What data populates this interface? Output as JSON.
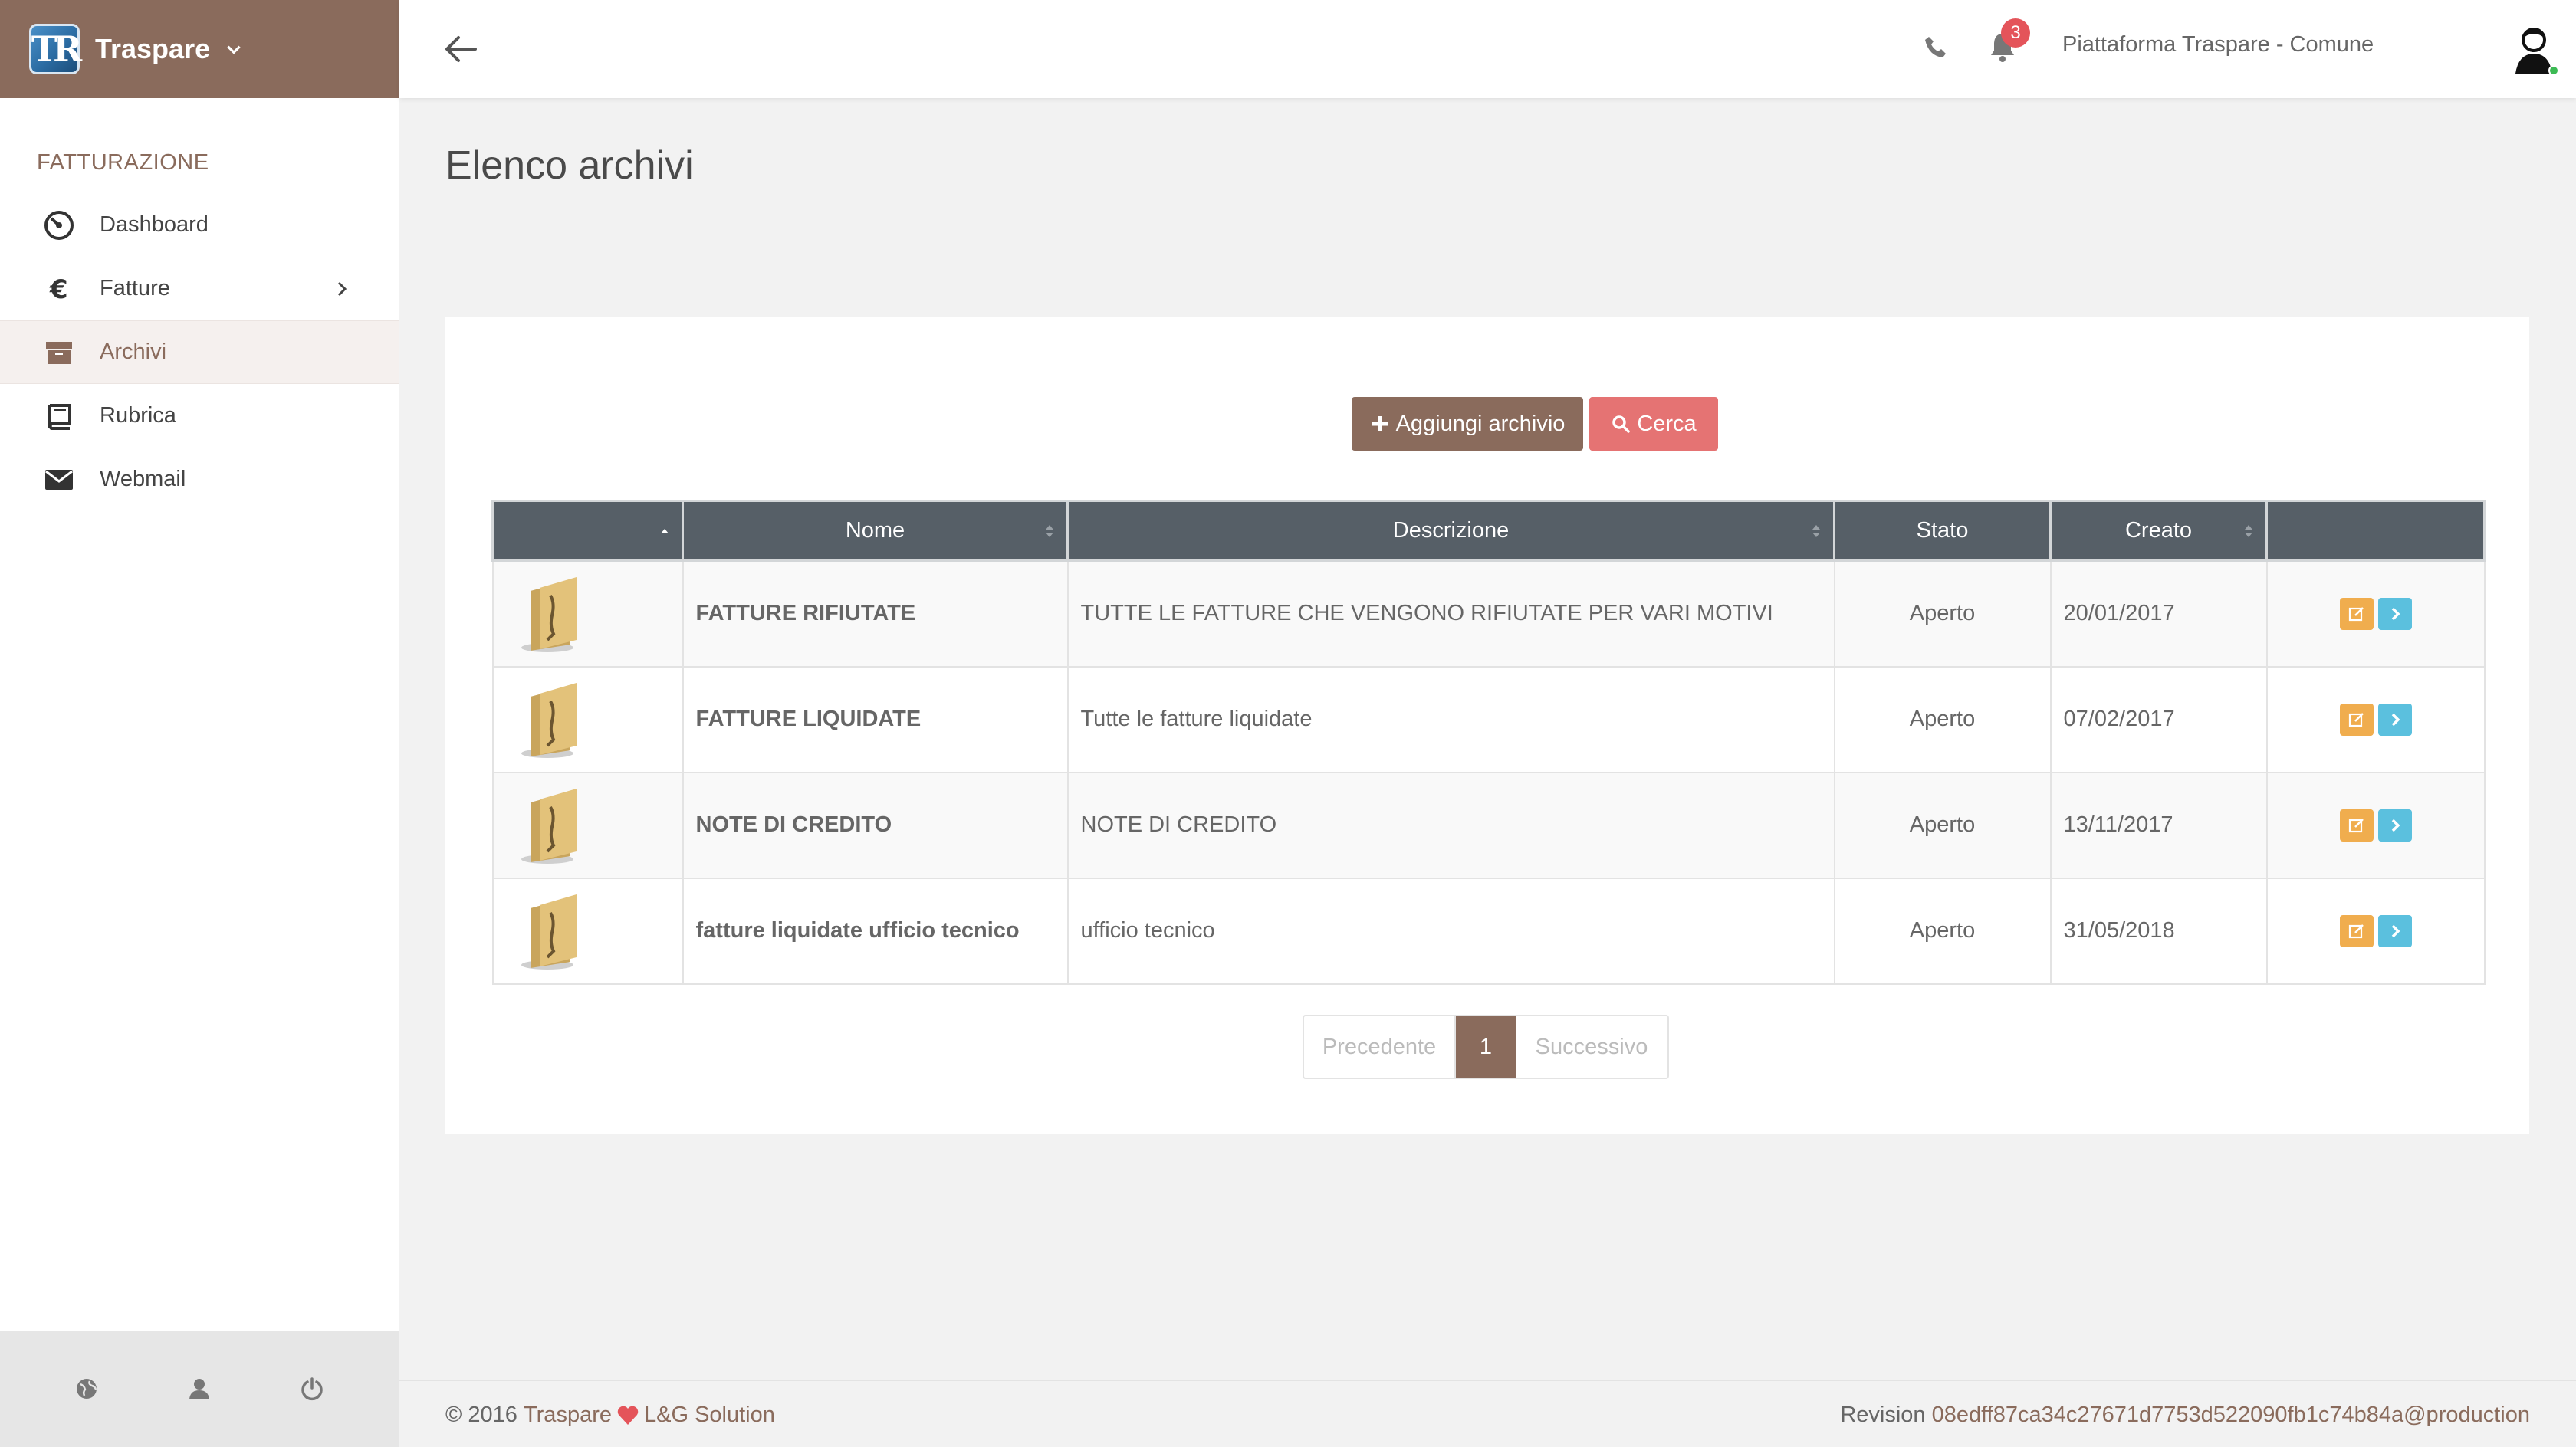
{
  "app": {
    "name": "Traspare",
    "logo_text": "TR"
  },
  "sidebar": {
    "section_title": "FATTURAZIONE",
    "items": [
      {
        "label": "Dashboard",
        "icon": "dashboard-icon"
      },
      {
        "label": "Fatture",
        "icon": "euro-icon",
        "has_submenu": true
      },
      {
        "label": "Archivi",
        "icon": "archive-icon",
        "active": true
      },
      {
        "label": "Rubrica",
        "icon": "book-icon"
      },
      {
        "label": "Webmail",
        "icon": "envelope-icon"
      }
    ],
    "footer_icons": [
      "globe-icon",
      "user-icon",
      "power-icon"
    ]
  },
  "topbar": {
    "notifications_count": "3",
    "org_name": "Piattaforma Traspare - Comune"
  },
  "page": {
    "title": "Elenco archivi"
  },
  "toolbar": {
    "add_label": "Aggiungi archivio",
    "search_label": "Cerca"
  },
  "table": {
    "columns": [
      "",
      "Nome",
      "Descrizione",
      "Stato",
      "Creato",
      ""
    ],
    "rows": [
      {
        "nome": "FATTURE RIFIUTATE",
        "descrizione": "TUTTE LE FATTURE CHE VENGONO RIFIUTATE PER VARI MOTIVI",
        "stato": "Aperto",
        "creato": "20/01/2017"
      },
      {
        "nome": "FATTURE LIQUIDATE",
        "descrizione": "Tutte le fatture liquidate",
        "stato": "Aperto",
        "creato": "07/02/2017"
      },
      {
        "nome": "NOTE DI CREDITO",
        "descrizione": "NOTE DI CREDITO",
        "stato": "Aperto",
        "creato": "13/11/2017"
      },
      {
        "nome": "fatture liquidate ufficio tecnico",
        "descrizione": "ufficio tecnico",
        "stato": "Aperto",
        "creato": "31/05/2018"
      }
    ]
  },
  "pagination": {
    "prev": "Precedente",
    "current": "1",
    "next": "Successivo"
  },
  "footer": {
    "copyright": "© 2016",
    "brand": "Traspare",
    "company": "L&G Solution",
    "revision_label": "Revision",
    "revision_hash": "08edff87ca34c27671d7753d522090fb1c74b84a@production"
  },
  "colors": {
    "brand": "#8a6b5c",
    "header_bg": "#565f67",
    "search_btn": "#e57373",
    "edit_btn": "#f0ad4e",
    "go_btn": "#5bc0de",
    "badge": "#e4545a"
  }
}
